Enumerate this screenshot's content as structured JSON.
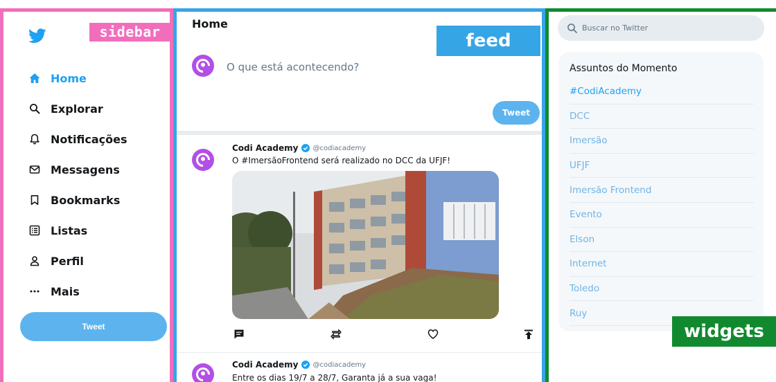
{
  "overlays": {
    "sidebar": "sidebar",
    "feed": "feed",
    "widgets": "widgets"
  },
  "sidebar": {
    "items": [
      {
        "label": "Home",
        "icon": "home-icon",
        "active": true
      },
      {
        "label": "Explorar",
        "icon": "search-icon"
      },
      {
        "label": "Notificações",
        "icon": "bell-icon"
      },
      {
        "label": "Messagens",
        "icon": "mail-icon"
      },
      {
        "label": "Bookmarks",
        "icon": "bookmark-icon"
      },
      {
        "label": "Listas",
        "icon": "list-icon"
      },
      {
        "label": "Perfil",
        "icon": "person-icon"
      },
      {
        "label": "Mais",
        "icon": "more-icon"
      }
    ],
    "tweet_button": "Tweet"
  },
  "feed": {
    "title": "Home",
    "compose": {
      "placeholder": "O que está acontecendo?",
      "tweet_button": "Tweet"
    },
    "posts": [
      {
        "name": "Codi Academy",
        "handle": "@codiacademy",
        "text": "O #ImersãoFrontend será realizado no DCC da UFJF!"
      },
      {
        "name": "Codi Academy",
        "handle": "@codiacademy",
        "text": "Entre os dias 19/7 a 28/7, Garanta já a sua vaga!"
      }
    ]
  },
  "widgets": {
    "search_placeholder": "Buscar no Twitter",
    "trends_title": "Assuntos do Momento",
    "trends": [
      "#CodiAcademy",
      "DCC",
      "Imersão",
      "UFJF",
      "Imersão Frontend",
      "Evento",
      "Elson",
      "Internet",
      "Toledo",
      "Ruy"
    ]
  },
  "colors": {
    "accent": "#1da1f2",
    "sidebar_frame": "#f26ebd",
    "feed_frame": "#36a5e6",
    "widgets_frame": "#118a2f",
    "avatar": "#b24fe6"
  }
}
